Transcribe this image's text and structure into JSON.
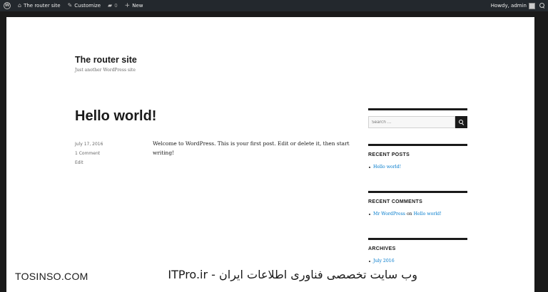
{
  "adminbar": {
    "site_name": "The router site",
    "customize": "Customize",
    "comments_count": "0",
    "new_label": "New",
    "howdy": "Howdy, admin"
  },
  "site": {
    "title": "The router site",
    "description": "Just another WordPress site"
  },
  "post": {
    "title": "Hello world!",
    "date": "July 17, 2016",
    "comments": "1 Comment",
    "edit": "Edit",
    "content": "Welcome to WordPress. This is your first post. Edit or delete it, then start writing!"
  },
  "sidebar": {
    "search_placeholder": "Search …",
    "recent_posts_title": "RECENT POSTS",
    "recent_posts": [
      "Hello world!"
    ],
    "recent_comments_title": "RECENT COMMENTS",
    "comment_author": "Mr WordPress",
    "comment_on": "on",
    "comment_post": "Hello world!",
    "archives_title": "ARCHIVES",
    "archives": [
      "July 2016"
    ]
  },
  "watermark": {
    "left": "TOSINSO.COM",
    "right": "ITPro.ir - وب سایت تخصصی فناوری اطلاعات ایران"
  }
}
